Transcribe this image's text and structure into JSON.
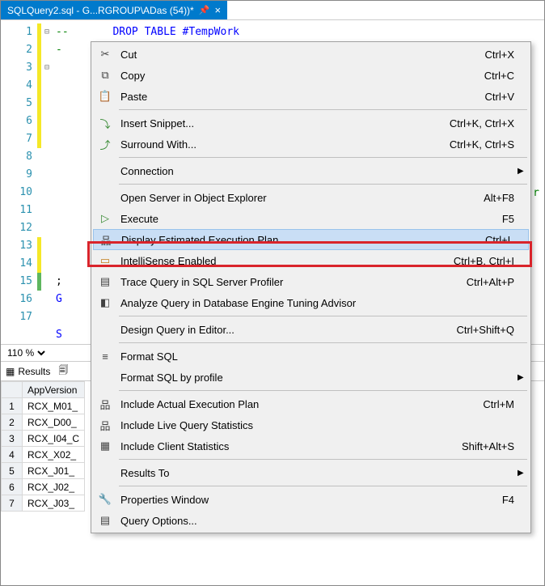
{
  "tab": {
    "title": "SQLQuery2.sql - G...RGROUP\\ADas (54))*"
  },
  "code": {
    "line1_comment": "--",
    "line1_code": "DROP TABLE #TempWork",
    "line2": "-",
    "line14_prefix": ";",
    "line15": "G",
    "line17": "S",
    "trail_r": "r"
  },
  "gutter": [
    "1",
    "2",
    "3",
    "4",
    "5",
    "6",
    "7",
    "8",
    "9",
    "10",
    "11",
    "12",
    "13",
    "14",
    "15",
    "16",
    "17"
  ],
  "menu": {
    "cut": {
      "label": "Cut",
      "shortcut": "Ctrl+X"
    },
    "copy": {
      "label": "Copy",
      "shortcut": "Ctrl+C"
    },
    "paste": {
      "label": "Paste",
      "shortcut": "Ctrl+V"
    },
    "insert_snippet": {
      "label": "Insert Snippet...",
      "shortcut": "Ctrl+K, Ctrl+X"
    },
    "surround_with": {
      "label": "Surround With...",
      "shortcut": "Ctrl+K, Ctrl+S"
    },
    "connection": {
      "label": "Connection"
    },
    "open_server": {
      "label": "Open Server in Object Explorer",
      "shortcut": "Alt+F8"
    },
    "execute": {
      "label": "Execute",
      "shortcut": "F5"
    },
    "display_plan": {
      "label": "Display Estimated Execution Plan",
      "shortcut": "Ctrl+L"
    },
    "intellisense": {
      "label": "IntelliSense Enabled",
      "shortcut": "Ctrl+B, Ctrl+I"
    },
    "trace": {
      "label": "Trace Query in SQL Server Profiler",
      "shortcut": "Ctrl+Alt+P"
    },
    "analyze": {
      "label": "Analyze Query in Database Engine Tuning Advisor"
    },
    "design": {
      "label": "Design Query in Editor...",
      "shortcut": "Ctrl+Shift+Q"
    },
    "format_sql": {
      "label": "Format SQL"
    },
    "format_profile": {
      "label": "Format SQL by profile"
    },
    "include_actual": {
      "label": "Include Actual Execution Plan",
      "shortcut": "Ctrl+M"
    },
    "include_live": {
      "label": "Include Live Query Statistics"
    },
    "include_client": {
      "label": "Include Client Statistics",
      "shortcut": "Shift+Alt+S"
    },
    "results_to": {
      "label": "Results To"
    },
    "properties": {
      "label": "Properties Window",
      "shortcut": "F4"
    },
    "query_options": {
      "label": "Query Options..."
    }
  },
  "zoom": {
    "value": "110 %"
  },
  "results": {
    "tab_results": "Results",
    "tab_messages_icon": "msg",
    "columns": [
      "",
      "AppVersion"
    ],
    "rows": [
      {
        "n": "1",
        "v": "RCX_M01_"
      },
      {
        "n": "2",
        "v": "RCX_D00_"
      },
      {
        "n": "3",
        "v": "RCX_I04_C"
      },
      {
        "n": "4",
        "v": "RCX_X02_"
      },
      {
        "n": "5",
        "v": "RCX_J01_"
      },
      {
        "n": "6",
        "v": "RCX_J02_"
      },
      {
        "n": "7",
        "v": "RCX_J03_"
      }
    ]
  }
}
